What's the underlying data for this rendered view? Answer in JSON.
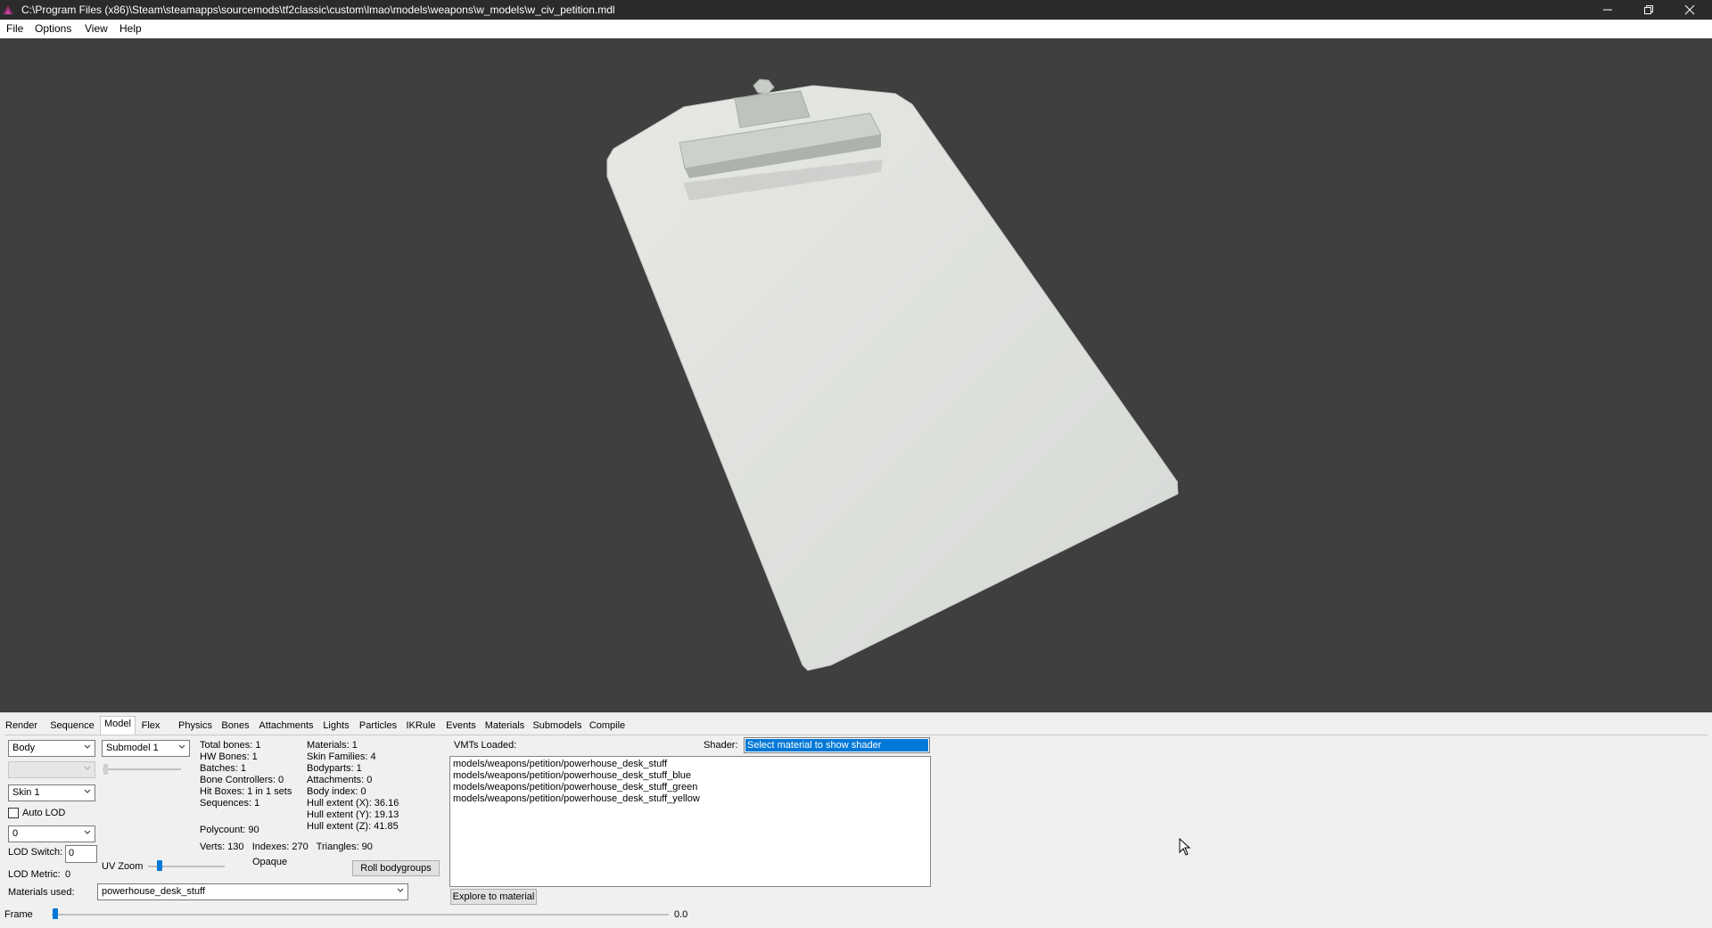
{
  "window": {
    "title": "C:\\Program Files (x86)\\Steam\\steamapps\\sourcemods\\tf2classic\\custom\\lmao\\models\\weapons\\w_models\\w_civ_petition.mdl",
    "controls": {
      "minimize": "—",
      "restore": "❐",
      "close": "✕"
    }
  },
  "menu": [
    "File",
    "Options",
    "View",
    "Help"
  ],
  "tabs": [
    "Render",
    "Sequence",
    "Model",
    "Flex",
    "Physics",
    "Bones",
    "Attachments",
    "Lights",
    "Particles",
    "IKRule",
    "Events",
    "Materials",
    "Submodels",
    "Compile"
  ],
  "active_tab": "Model",
  "model_panel": {
    "body_select": "Body",
    "submodel_select": "Submodel 1",
    "skin_select": "Skin 1",
    "auto_lod_label": "Auto LOD",
    "auto_lod_checked": false,
    "lod_select": "0",
    "lod_switch_label": "LOD Switch:",
    "lod_switch_value": "0",
    "lod_metric_label": "LOD Metric:",
    "lod_metric_value": "0",
    "uv_zoom_label": "UV Zoom",
    "opaque_label": "Opaque",
    "roll_bodygroups_button": "Roll bodygroups",
    "materials_used_label": "Materials used:",
    "materials_used_value": "powerhouse_desk_stuff"
  },
  "stats_left": [
    "Total bones: 1",
    "HW Bones: 1",
    "Batches: 1",
    "Bone Controllers: 0",
    "Hit Boxes: 1 in 1 sets",
    "Sequences: 1"
  ],
  "stats_right": [
    "Materials: 1",
    "Skin Families: 4",
    "Bodyparts: 1",
    "Attachments: 0",
    "Body index: 0",
    "Hull extent (X): 36.16",
    "Hull extent (Y): 19.13",
    "Hull extent (Z): 41.85"
  ],
  "polycount": "Polycount: 90",
  "geometry_line": "Verts: 130   Indexes: 270   Triangles: 90",
  "vmts": {
    "label": "VMTs Loaded:",
    "shader_label": "Shader:",
    "shader_value": "Select material to show shader",
    "items": [
      "models/weapons/petition/powerhouse_desk_stuff",
      "models/weapons/petition/powerhouse_desk_stuff_blue",
      "models/weapons/petition/powerhouse_desk_stuff_green",
      "models/weapons/petition/powerhouse_desk_stuff_yellow"
    ],
    "explore_button": "Explore to material"
  },
  "frame": {
    "label": "Frame",
    "value": "0.0"
  },
  "colors": {
    "viewport_bg": "#3f3f3f",
    "titlebar_bg": "#2b2b2b",
    "model_face": "#dde0dc",
    "accent": "#0078d7"
  }
}
